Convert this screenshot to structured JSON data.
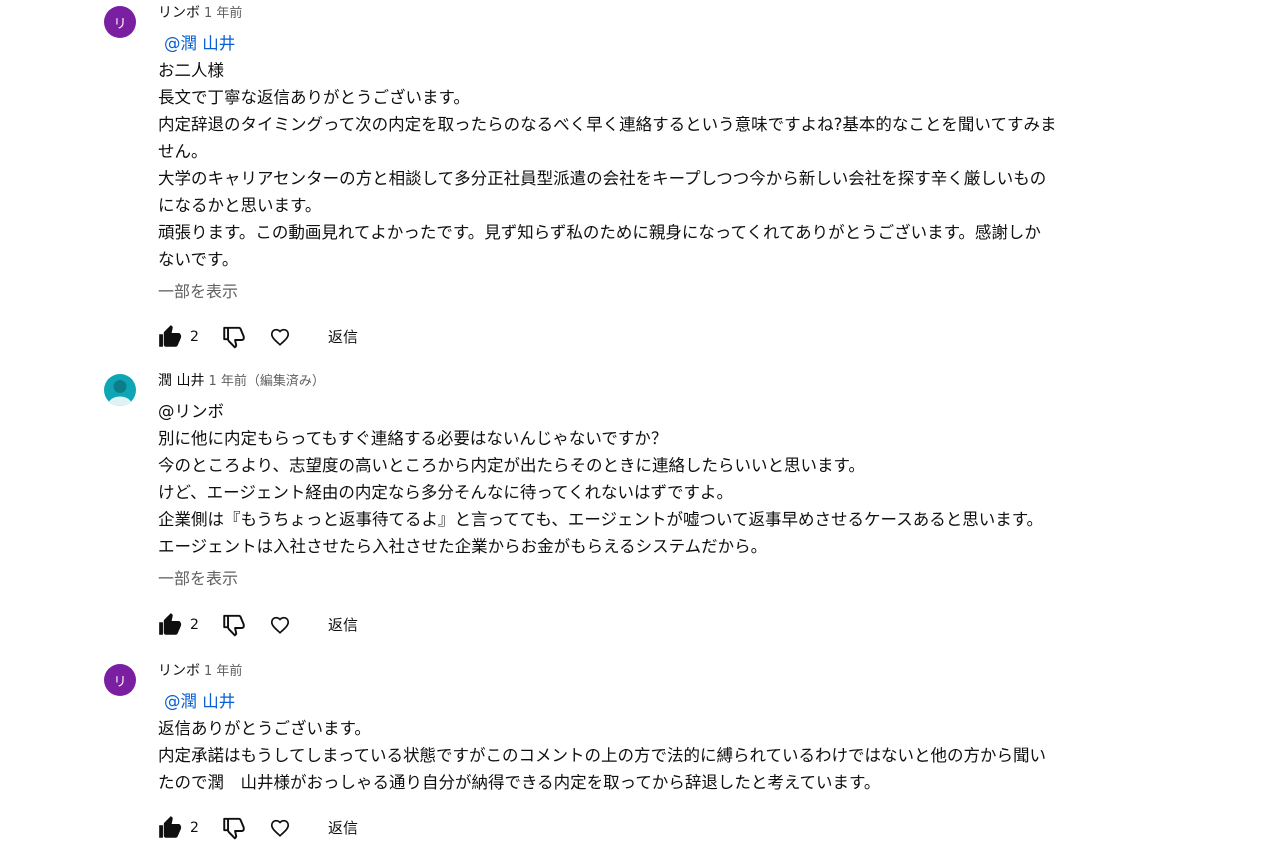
{
  "comments": [
    {
      "avatar_letter": "リ",
      "avatar_color": "#7b1fa2",
      "author": "リンボ",
      "meta": "1 年前",
      "mention": "@潤 山井",
      "lines": [
        "お二人様",
        "長文で丁寧な返信ありがとうございます。",
        "内定辞退のタイミングって次の内定を取ったらのなるべく早く連絡するという意味ですよね?基本的なことを聞いてすみま",
        "せん。",
        "大学のキャリアセンターの方と相談して多分正社員型派遣の会社をキープしつつ今から新しい会社を探す辛く厳しいもの",
        "になるかと思います。",
        "頑張ります。この動画見れてよかったです。見ず知らず私のために親身になってくれてありがとうございます。感謝しか",
        "ないです。"
      ],
      "show_more": "一部を表示",
      "likes": "2",
      "reply": "返信"
    },
    {
      "avatar_color": "#0ea5b4",
      "author": "潤 山井",
      "meta": "1 年前（編集済み）",
      "lines": [
        "@リンボ",
        "別に他に内定もらってもすぐ連絡する必要はないんじゃないですか？",
        "今のところより、志望度の高いところから内定が出たらそのときに連絡したらいいと思います。",
        "けど、エージェント経由の内定なら多分そんなに待ってくれないはずですよ。",
        "企業側は『もうちょっと返事待てるよ』と言ってても、エージェントが嘘ついて返事早めさせるケースあると思います。",
        "エージェントは入社させたら入社させた企業からお金がもらえるシステムだから。"
      ],
      "show_more": "一部を表示",
      "likes": "2",
      "reply": "返信"
    },
    {
      "avatar_letter": "リ",
      "avatar_color": "#7b1fa2",
      "author": "リンボ",
      "meta": "1 年前",
      "mention": "@潤 山井",
      "lines": [
        "返信ありがとうございます。",
        "内定承諾はもうしてしまっている状態ですがこのコメントの上の方で法的に縛られているわけではないと他の方から聞い",
        "たので潤　山井様がおっしゃる通り自分が納得できる内定を取ってから辞退したと考えています。"
      ],
      "likes": "2",
      "reply": "返信"
    }
  ]
}
